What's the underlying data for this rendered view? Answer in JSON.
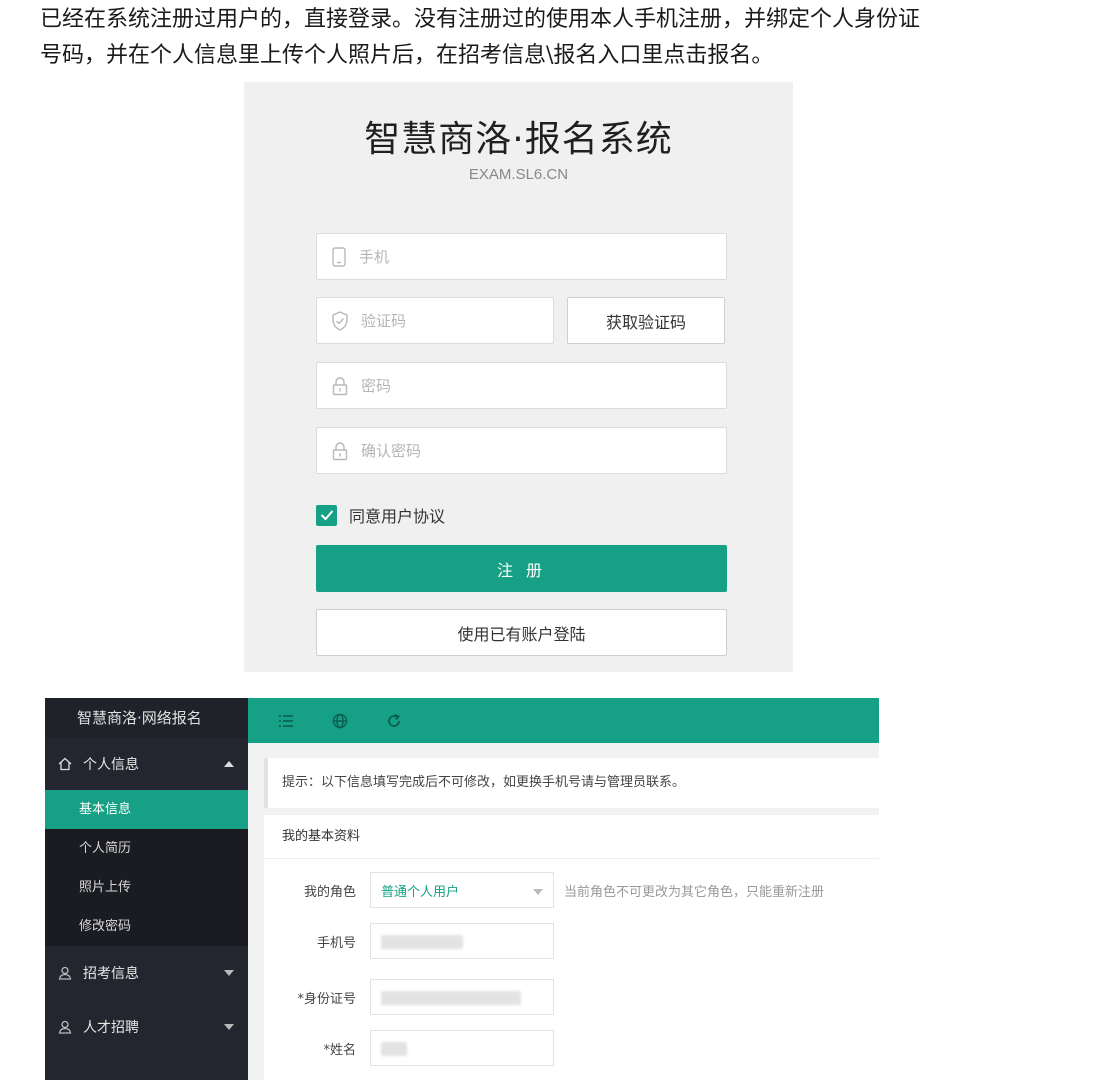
{
  "instructions": {
    "line1": "已经在系统注册过用户的，直接登录。没有注册过的使用本人手机注册，并绑定个人身份证",
    "line2": "号码，并在个人信息里上传个人照片后，在招考信息\\报名入口里点击报名。"
  },
  "register": {
    "title": "智慧商洛·报名系统",
    "subtitle": "EXAM.SL6.CN",
    "phone_placeholder": "手机",
    "code_placeholder": "验证码",
    "get_code_label": "获取验证码",
    "password_placeholder": "密码",
    "confirm_placeholder": "确认密码",
    "agree_label": "同意用户协议",
    "agree_checked": true,
    "submit_label": "注 册",
    "login_label": "使用已有账户登陆",
    "accent_color": "#16a085"
  },
  "admin": {
    "sidebar": {
      "logo": "智慧商洛·网络报名",
      "group_personal": "个人信息",
      "sub_items": [
        "基本信息",
        "个人简历",
        "照片上传",
        "修改密码"
      ],
      "active_index": 0,
      "group_exam": "招考信息",
      "group_talent": "人才招聘"
    },
    "topbar_icons": [
      "menu-icon",
      "globe-icon",
      "refresh-icon"
    ],
    "tip": "提示：以下信息填写完成后不可修改，如更换手机号请与管理员联系。",
    "card_title": "我的基本资料",
    "form": {
      "role_label": "我的角色",
      "role_value": "普通个人用户",
      "role_hint": "当前角色不可更改为其它角色，只能重新注册",
      "phone_label": "手机号",
      "id_label": "*身份证号",
      "name_label": "*姓名"
    }
  }
}
